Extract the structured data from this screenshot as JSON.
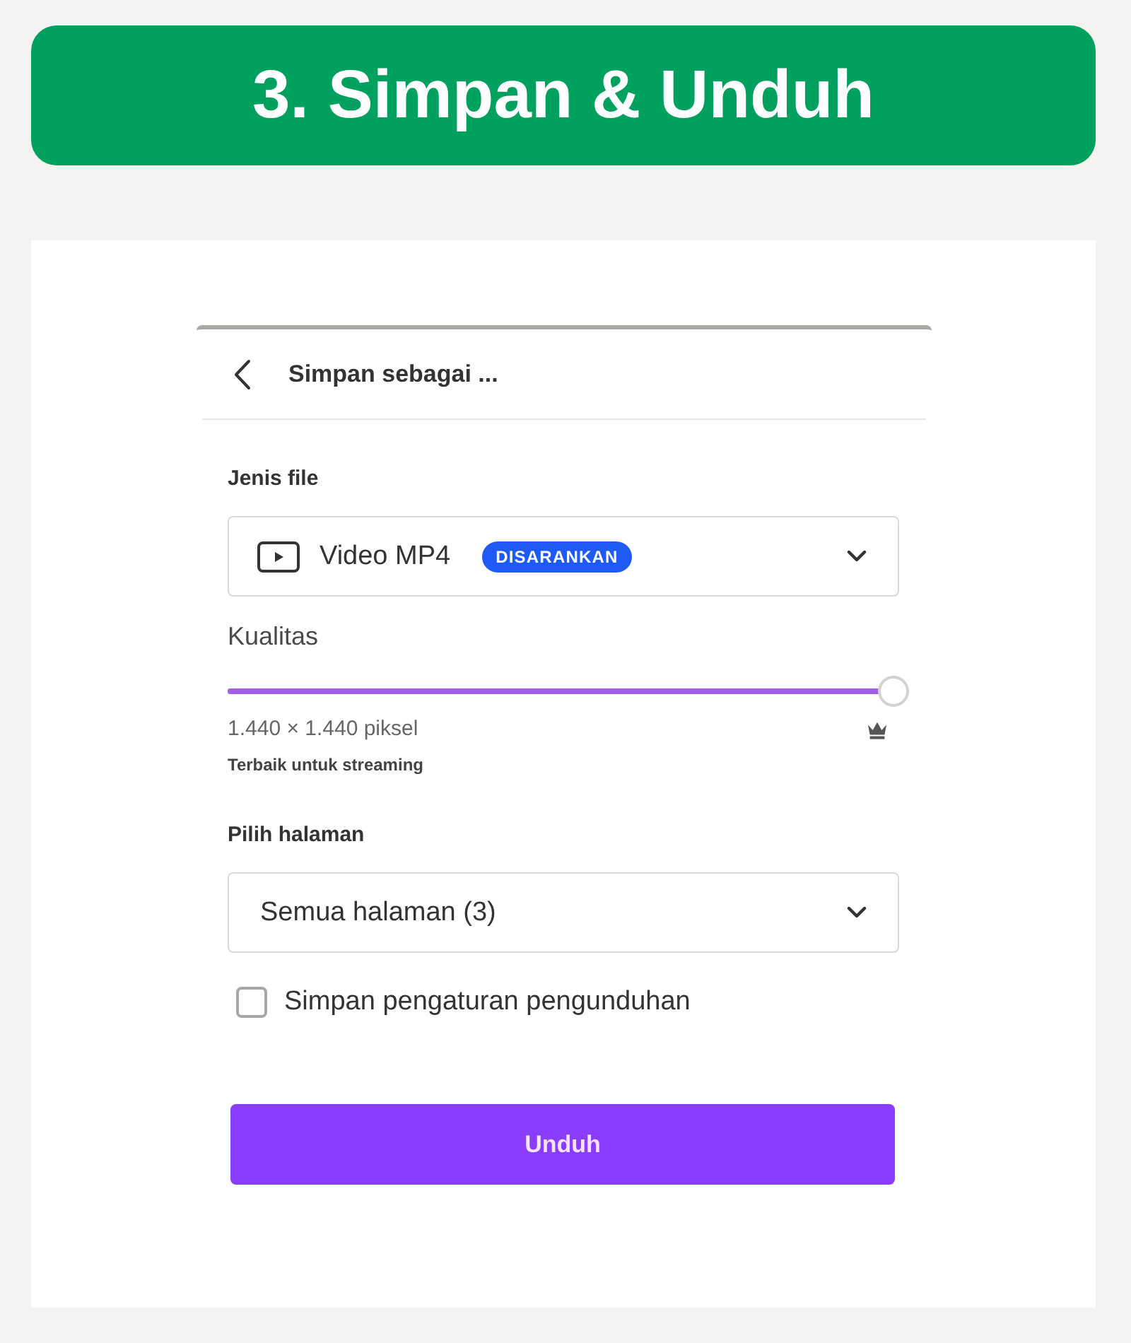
{
  "banner": {
    "title": "3. Simpan & Unduh"
  },
  "dialog": {
    "title": "Simpan sebagai ...",
    "file_type": {
      "label": "Jenis file",
      "value": "Video MP4",
      "badge": "DISARANKAN"
    },
    "quality": {
      "label": "Kualitas",
      "level": 1.0,
      "resolution": "1.440 × 1.440 piksel",
      "note": "Terbaik untuk streaming"
    },
    "pages": {
      "label": "Pilih halaman",
      "value": "Semua halaman (3)"
    },
    "save_settings": {
      "label": "Simpan pengaturan pengunduhan",
      "checked": false
    },
    "download_button": {
      "label": "Unduh"
    }
  }
}
